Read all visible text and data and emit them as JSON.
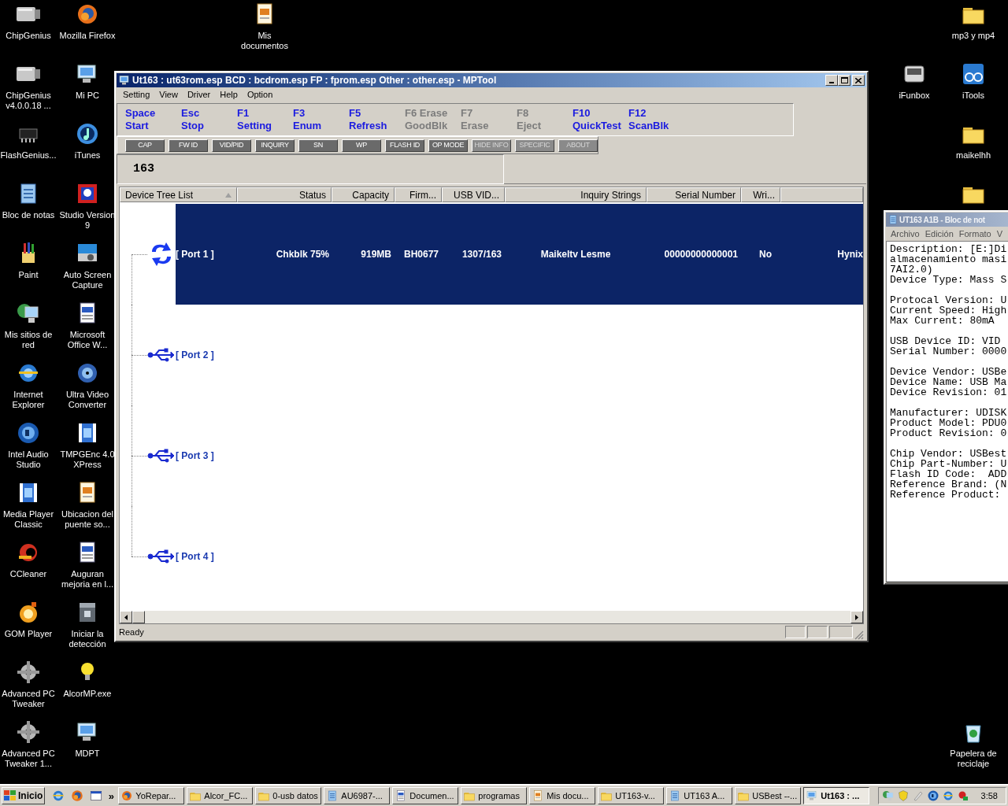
{
  "desktop": {
    "left_icons": [
      {
        "label": "ChipGenius",
        "kind": "usb"
      },
      {
        "label": "ChipGenius v4.0.0.18  ...",
        "kind": "usb"
      },
      {
        "label": "FlashGenius...",
        "kind": "chip"
      },
      {
        "label": "Bloc de notas",
        "kind": "notepad"
      },
      {
        "label": "Paint",
        "kind": "paint"
      },
      {
        "label": "Mis sitios de red",
        "kind": "network"
      },
      {
        "label": "Internet Explorer",
        "kind": "ie"
      },
      {
        "label": "Intel Audio Studio",
        "kind": "speaker"
      },
      {
        "label": "Media Player Classic",
        "kind": "film"
      },
      {
        "label": "CCleaner",
        "kind": "cleaner"
      },
      {
        "label": "GOM Player",
        "kind": "gom"
      },
      {
        "label": "Advanced PC Tweaker",
        "kind": "gear"
      },
      {
        "label": "Advanced PC Tweaker 1...",
        "kind": "gear"
      },
      {
        "label": "Mozilla Firefox",
        "kind": "firefox"
      },
      {
        "label": "Mi PC",
        "kind": "computer"
      },
      {
        "label": "iTunes",
        "kind": "music"
      },
      {
        "label": "Studio Version 9",
        "kind": "studio"
      },
      {
        "label": "Auto Screen Capture",
        "kind": "camera"
      },
      {
        "label": "Microsoft Office W...",
        "kind": "word"
      },
      {
        "label": "Ultra Video Converter",
        "kind": "disc"
      },
      {
        "label": "TMPGEnc 4.0 XPress",
        "kind": "film"
      },
      {
        "label": "Ubicacion del puente so...",
        "kind": "doc"
      },
      {
        "label": "Auguran mejoria en l...",
        "kind": "word"
      },
      {
        "label": "Iniciar la detección",
        "kind": "box"
      },
      {
        "label": "AlcorMP.exe",
        "kind": "bulb"
      },
      {
        "label": "MDPT",
        "kind": "computer"
      }
    ],
    "top_icons": [
      {
        "label": "Mis documentos",
        "kind": "doc"
      }
    ],
    "right_icons": [
      {
        "label": "mp3 y mp4",
        "kind": "folder"
      },
      {
        "label": "iFunbox",
        "kind": "drive"
      },
      {
        "label": "iTools",
        "kind": "bike"
      },
      {
        "label": "maikelhh",
        "kind": "folder"
      },
      {
        "kind": "folder"
      },
      {
        "label": "Papelera de reciclaje",
        "kind": "trash"
      }
    ]
  },
  "mptool": {
    "title": "Ut163 : ut63rom.esp BCD : bcdrom.esp FP : fprom.esp Other : other.esp - MPTool",
    "menu": [
      "Setting",
      "View",
      "Driver",
      "Help",
      "Option"
    ],
    "function_keys": [
      {
        "key": "Space",
        "action": "Start",
        "disabled": false
      },
      {
        "key": "Esc",
        "action": "Stop",
        "disabled": false
      },
      {
        "key": "F1",
        "action": "Setting",
        "disabled": false
      },
      {
        "key": "F3",
        "action": "Enum",
        "disabled": false
      },
      {
        "key": "F5",
        "action": "Refresh",
        "disabled": false
      },
      {
        "key": "F6 Erase",
        "action": "GoodBlk",
        "disabled": true
      },
      {
        "key": "F7",
        "action": "Erase",
        "disabled": true
      },
      {
        "key": "F8",
        "action": "Eject",
        "disabled": true
      },
      {
        "key": "F10",
        "action": "QuickTest",
        "disabled": false
      },
      {
        "key": "F12",
        "action": "ScanBlk",
        "disabled": false
      }
    ],
    "buttons": [
      {
        "label": "CAP",
        "disabled": false
      },
      {
        "label": "FW ID",
        "disabled": false
      },
      {
        "label": "VID/PID",
        "disabled": false
      },
      {
        "label": "INQUIRY",
        "disabled": false
      },
      {
        "label": "SN",
        "disabled": false
      },
      {
        "label": "WP",
        "disabled": false
      },
      {
        "label": "FLASH ID",
        "disabled": false
      },
      {
        "label": "OP MODE",
        "disabled": false
      },
      {
        "label": "HIDE INFO",
        "disabled": true
      },
      {
        "label": "SPECIFIC",
        "disabled": true
      },
      {
        "label": "ABOUT",
        "disabled": true
      }
    ],
    "model": "163",
    "columns": [
      "Device Tree List",
      "Status",
      "Capacity",
      "Firm...",
      "USB VID...",
      "Inquiry Strings",
      "Serial Number",
      "Wri..."
    ],
    "rows": [
      {
        "port": "[ Port  1 ]",
        "kind": "busy",
        "selected": true,
        "cells": [
          "Chkblk 75%",
          "919MB",
          "BH0677",
          "1307/163",
          "Maikeltv Lesme",
          "00000000000001",
          "No",
          "Hynix"
        ]
      },
      {
        "port": "[ Port  2 ]",
        "kind": "usb",
        "selected": false
      },
      {
        "port": "[ Port  3 ]",
        "kind": "usb",
        "selected": false
      },
      {
        "port": "[ Port  4 ]",
        "kind": "usb",
        "selected": false
      }
    ],
    "status": "Ready"
  },
  "notepad": {
    "title": "UT163 A1B - Bloc de not",
    "menu": [
      "Archivo",
      "Edición",
      "Formato",
      "V"
    ],
    "paragraphs": [
      [
        "Description: [E:]Di",
        "almacenamiento masi",
        "7AI2.0)",
        "Device Type: Mass S"
      ],
      [
        "Protocal Version: U",
        "Current Speed: High",
        "Max Current: 80mA"
      ],
      [
        "USB Device ID: VID",
        "Serial Number: 0000"
      ],
      [
        "Device Vendor: USBe",
        "Device Name: USB Ma",
        "Device Revision: 01"
      ],
      [
        "Manufacturer: UDISK",
        "Product Model: PDU0",
        "Product Revision: 0"
      ],
      [
        "Chip Vendor: USBest",
        "Chip Part-Number: U",
        "Flash ID Code:  ADD",
        "Reference Brand: (N",
        "Reference Product:"
      ]
    ]
  },
  "taskbar": {
    "start": "Inicio",
    "more": "»",
    "tasks": [
      {
        "label": "YoRepar...",
        "kind": "firefox",
        "selected": false
      },
      {
        "label": "Alcor_FC...",
        "kind": "folder",
        "selected": false
      },
      {
        "label": "0-usb datos",
        "kind": "folder",
        "selected": false
      },
      {
        "label": "AU6987-...",
        "kind": "notepad",
        "selected": false
      },
      {
        "label": "Documen...",
        "kind": "word",
        "selected": false
      },
      {
        "label": "programas",
        "kind": "folder",
        "selected": false
      },
      {
        "label": "Mis docu...",
        "kind": "doc",
        "selected": false
      },
      {
        "label": "UT163-v...",
        "kind": "folder",
        "selected": false
      },
      {
        "label": "UT163 A...",
        "kind": "notepad",
        "selected": false
      },
      {
        "label": "USBest --...",
        "kind": "folder",
        "selected": false
      },
      {
        "label": "Ut163 : ...",
        "kind": "computer",
        "selected": true
      }
    ],
    "clock": "3:58"
  }
}
